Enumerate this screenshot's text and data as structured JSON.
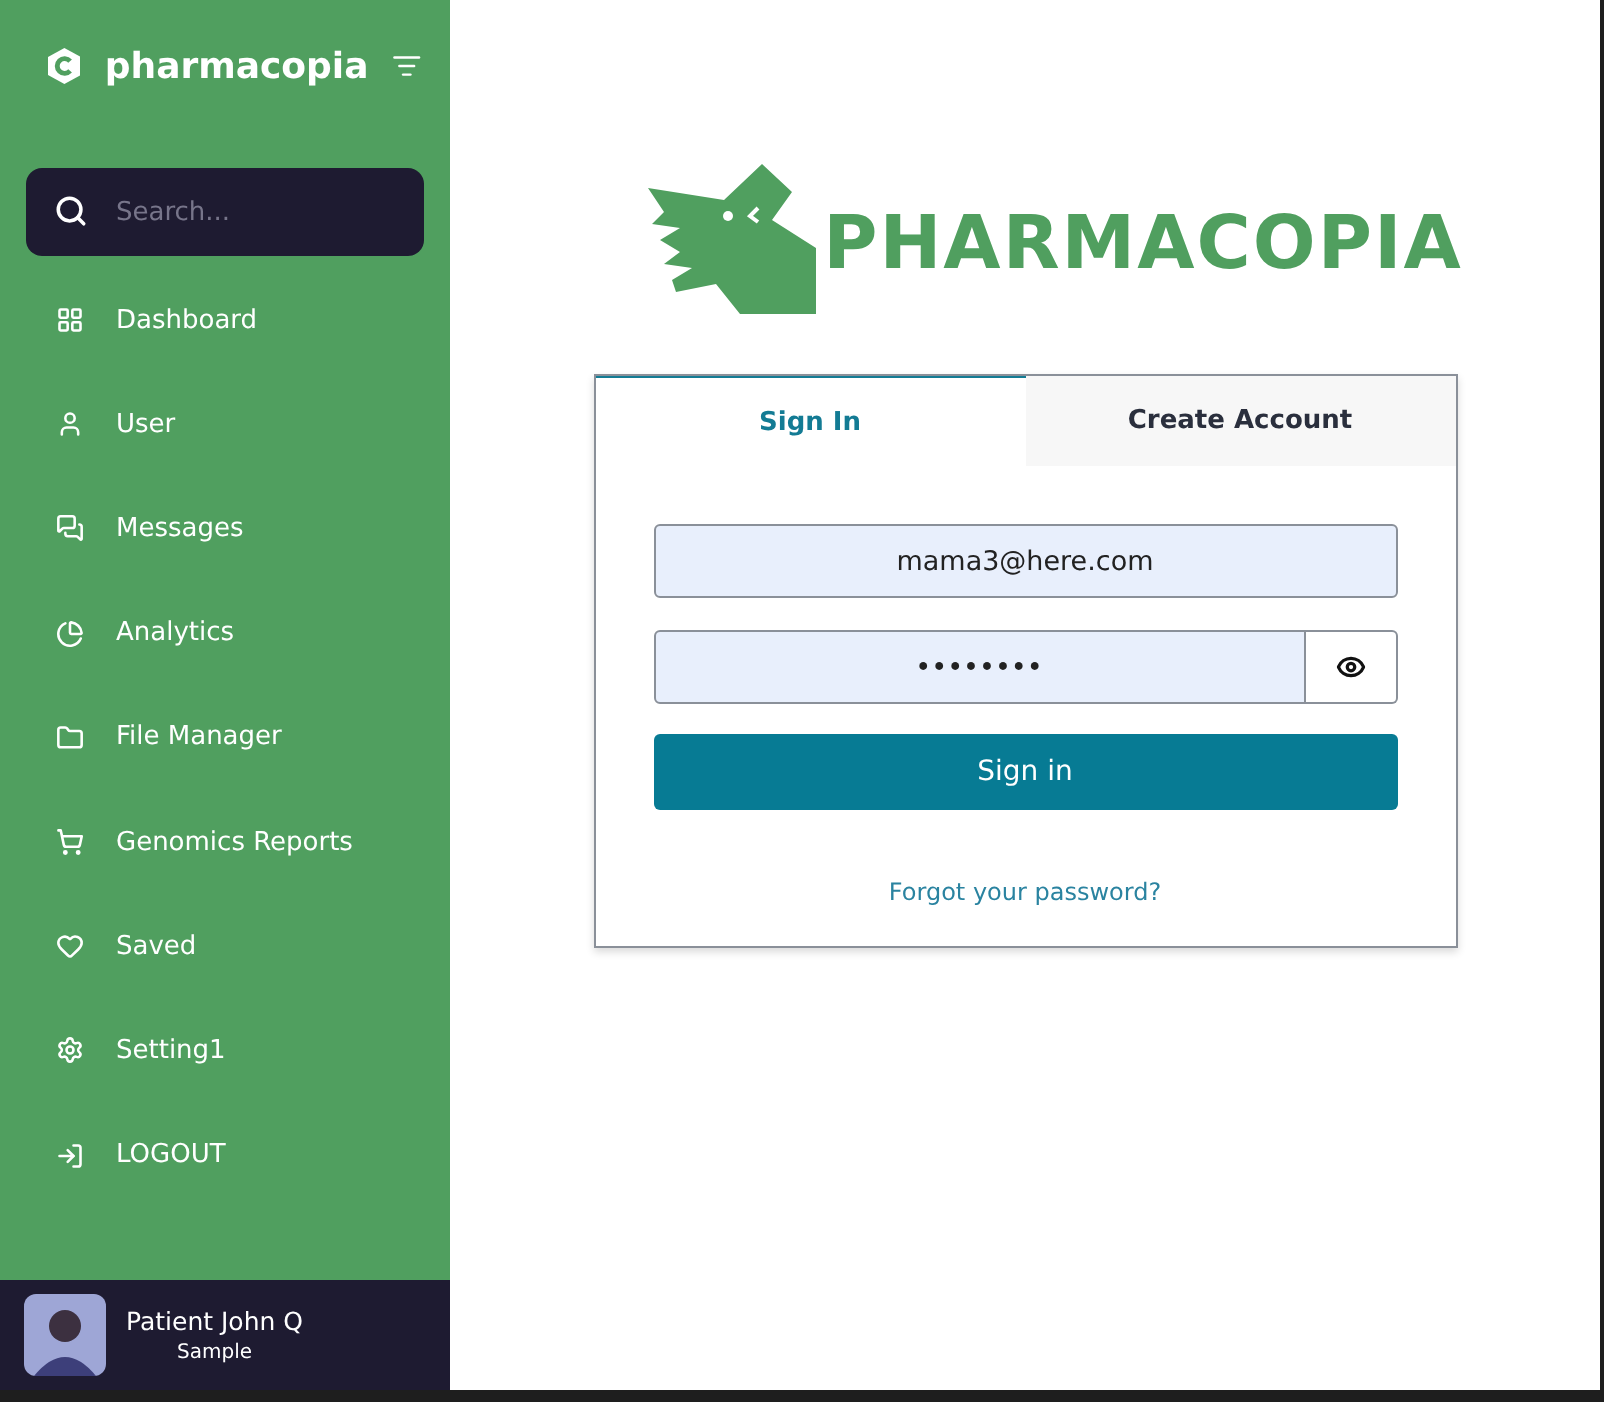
{
  "sidebar": {
    "brand": "pharmacopia",
    "search": {
      "placeholder": "Search..."
    },
    "items": [
      {
        "kind": "dashboard",
        "label": "Dashboard"
      },
      {
        "kind": "user",
        "label": "User"
      },
      {
        "kind": "messages",
        "label": "Messages"
      },
      {
        "kind": "analytics",
        "label": "Analytics"
      },
      {
        "kind": "files",
        "label": "File Manager"
      },
      {
        "kind": "cart",
        "label": "Genomics Reports"
      },
      {
        "kind": "saved",
        "label": "Saved"
      },
      {
        "kind": "settings",
        "label": "Setting1"
      },
      {
        "kind": "logout",
        "label": "LOGOUT"
      }
    ],
    "profile": {
      "name": "Patient John Q",
      "role": "Sample"
    }
  },
  "logo": {
    "text": "PHARMACOPIA"
  },
  "tabs": [
    {
      "label": "Sign In",
      "selected": true
    },
    {
      "label": "Create Account",
      "selected": false
    }
  ],
  "form": {
    "email": "mama3@here.com",
    "password": "••••••••",
    "submit": "Sign in",
    "forgot": "Forgot your password?"
  }
}
